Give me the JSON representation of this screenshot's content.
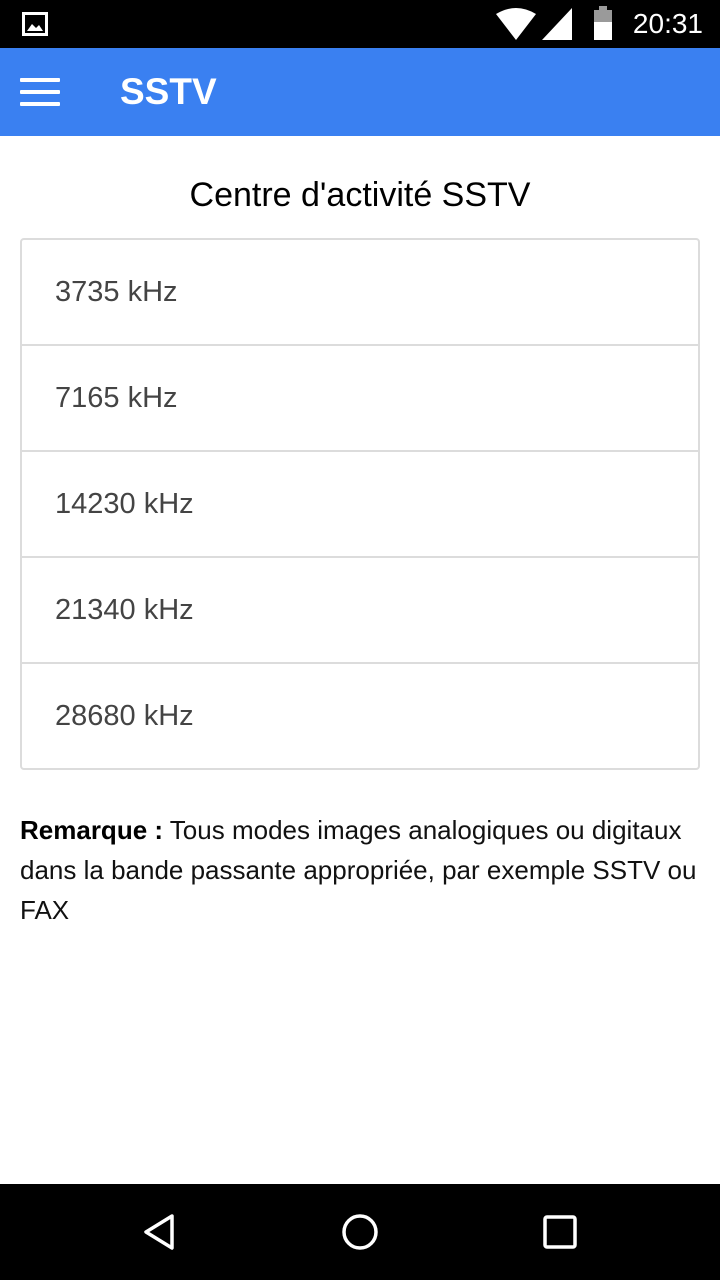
{
  "status_bar": {
    "time": "20:31",
    "icons": [
      "image-notification-icon",
      "wifi-icon",
      "signal-icon",
      "battery-icon"
    ]
  },
  "app_bar": {
    "title": "SSTV",
    "menu_icon": "menu-icon",
    "background_color": "#3a80f1"
  },
  "main": {
    "heading": "Centre d'activité SSTV",
    "frequencies": [
      {
        "label": "3735 kHz"
      },
      {
        "label": "7165 kHz"
      },
      {
        "label": "14230 kHz"
      },
      {
        "label": "21340 kHz"
      },
      {
        "label": "28680 kHz"
      }
    ],
    "remark": {
      "label": "Remarque :",
      "text": " Tous modes images analogiques ou digitaux dans la bande passante appropriée, par exemple SSTV ou FAX"
    }
  },
  "nav_bar": {
    "buttons": [
      "back-icon",
      "home-icon",
      "recents-icon"
    ]
  }
}
